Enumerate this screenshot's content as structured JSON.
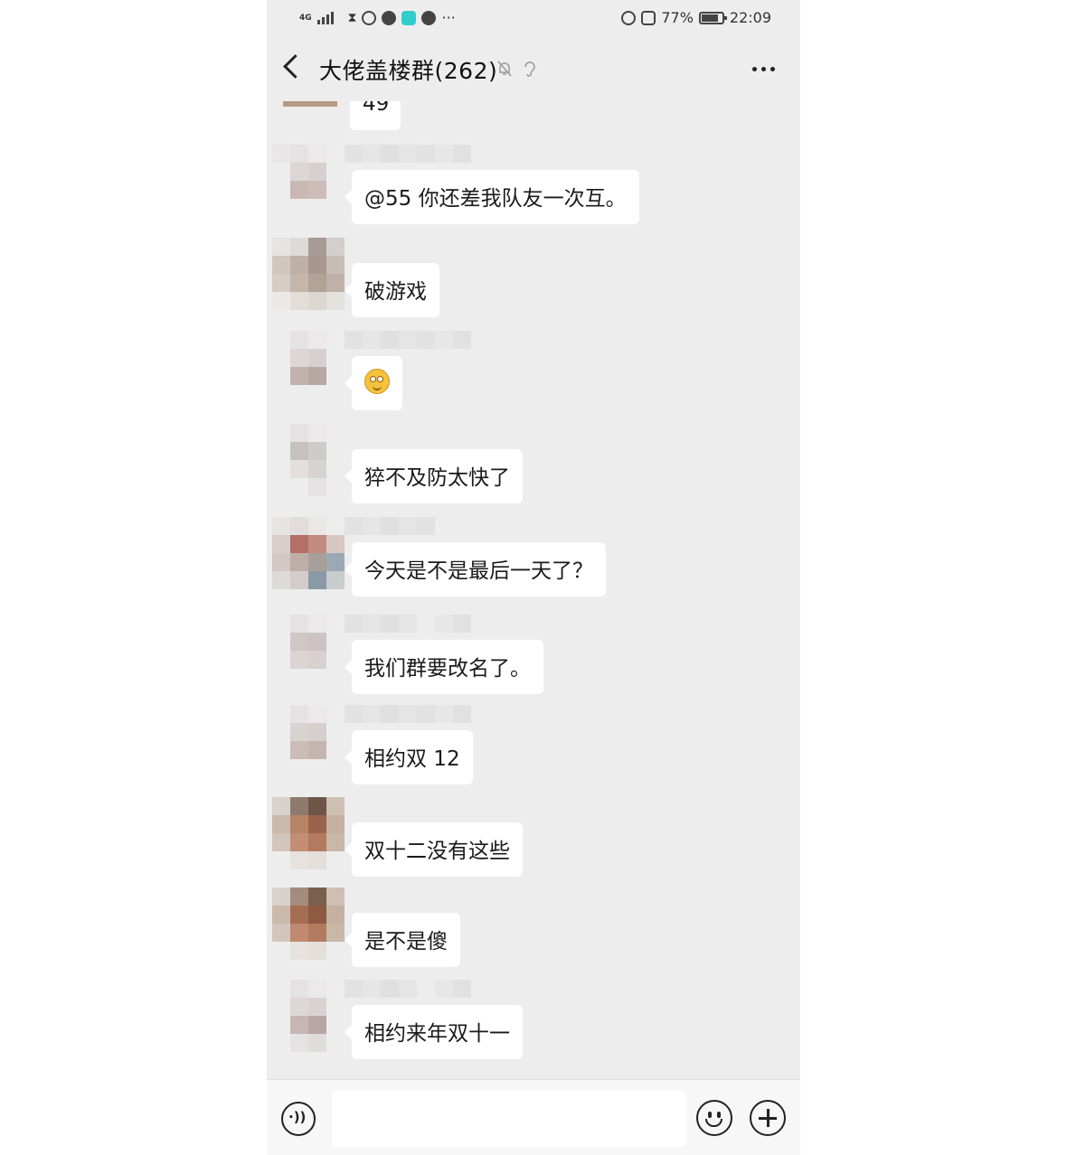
{
  "status_bar": {
    "network": "4G",
    "battery": "77%",
    "time": "22:09",
    "icons": [
      "signal-icon",
      "hourglass-icon",
      "weibo-icon",
      "wechat-icon",
      "app-icon",
      "compass-icon",
      "more-dots-icon",
      "alarm-icon",
      "mute-icon",
      "battery-icon"
    ]
  },
  "header": {
    "title": "大佬盖楼群(262)",
    "icons": [
      "back-icon",
      "mute-icon",
      "ear-icon",
      "more-icon"
    ]
  },
  "partial_message": {
    "text": "49"
  },
  "messages": [
    {
      "text": "@55 你还差我队友一次互。"
    },
    {
      "text": "破游戏"
    },
    {
      "text": "",
      "emoji": "smile-emoji"
    },
    {
      "text": "猝不及防太快了"
    },
    {
      "text": "今天是不是最后一天了？"
    },
    {
      "text": "我们群要改名了。"
    },
    {
      "text": "相约双 12"
    },
    {
      "text": "双十二没有这些"
    },
    {
      "text": "是不是傻"
    },
    {
      "text": "相约来年双十一"
    }
  ],
  "input_bar": {
    "placeholder": "",
    "icons": [
      "voice-icon",
      "emoji-icon",
      "plus-icon"
    ]
  },
  "colors": {
    "chat_bg": "#ededed",
    "bubble_bg": "#ffffff",
    "text": "#1a1a1a"
  }
}
